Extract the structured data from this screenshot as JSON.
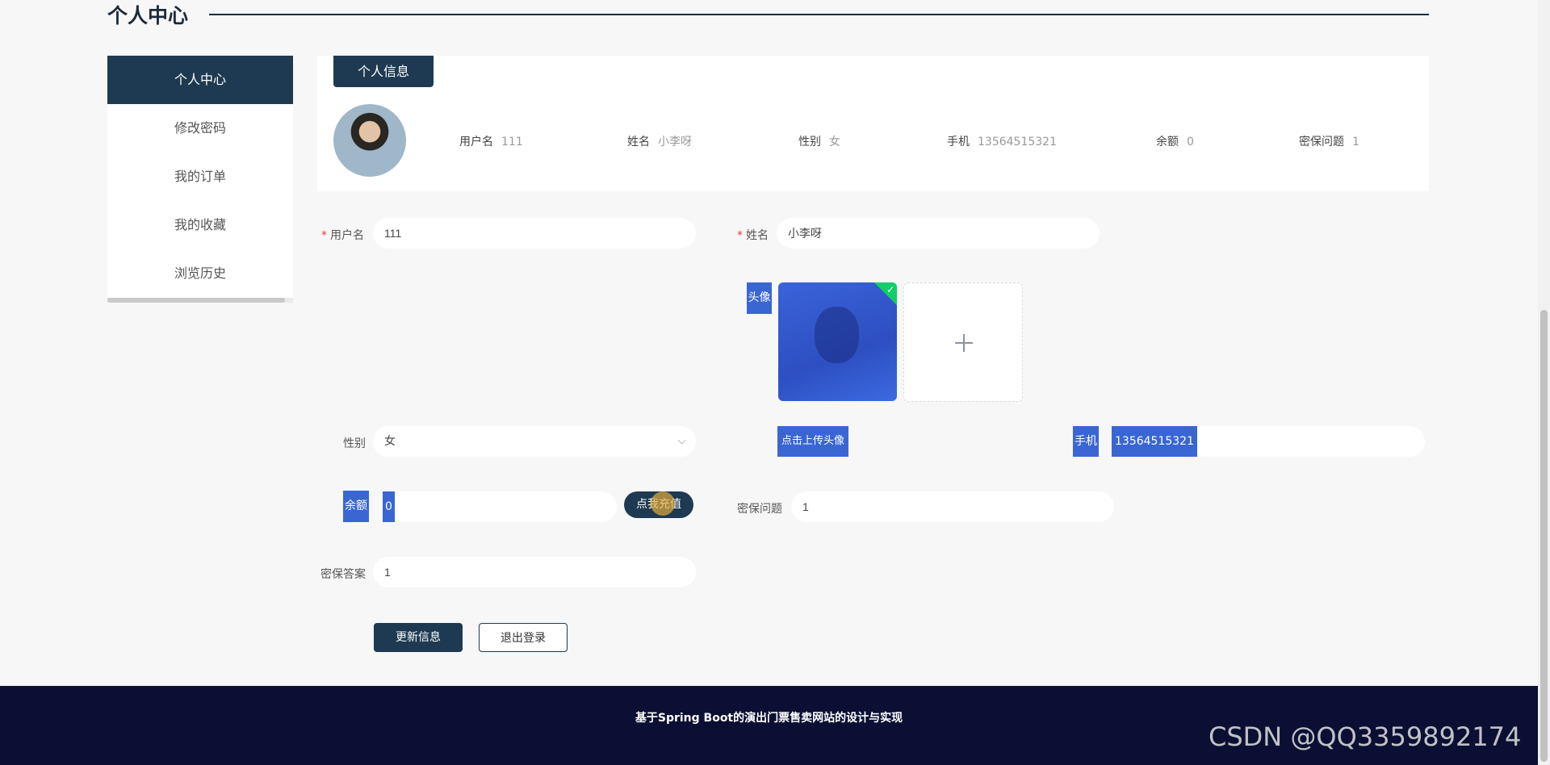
{
  "header": {
    "title": "个人中心"
  },
  "sidebar": {
    "items": [
      {
        "label": "个人中心"
      },
      {
        "label": "修改密码"
      },
      {
        "label": "我的订单"
      },
      {
        "label": "我的收藏"
      },
      {
        "label": "浏览历史"
      }
    ]
  },
  "info_card": {
    "tab_label": "个人信息",
    "fields": [
      {
        "label": "用户名",
        "value": "111"
      },
      {
        "label": "姓名",
        "value": "小李呀"
      },
      {
        "label": "性别",
        "value": "女"
      },
      {
        "label": "手机",
        "value": "13564515321"
      },
      {
        "label": "余额",
        "value": "0"
      },
      {
        "label": "密保问题",
        "value": "1"
      }
    ]
  },
  "form": {
    "username": {
      "required_mark": "*",
      "label": "用户名",
      "value": "111"
    },
    "name": {
      "required_mark": "*",
      "label": "姓名",
      "value": "小李呀"
    },
    "avatar": {
      "label": "头像"
    },
    "upload_button": "点击上传头像",
    "gender": {
      "label": "性别",
      "value": "女"
    },
    "phone": {
      "label": "手机",
      "value": "13564515321"
    },
    "balance": {
      "label": "余额",
      "value": "0"
    },
    "recharge_button": "点我充值",
    "security_question": {
      "label": "密保问题",
      "value": "1"
    },
    "security_answer": {
      "label": "密保答案",
      "value": "1"
    },
    "update_button": "更新信息",
    "logout_button": "退出登录"
  },
  "footer": {
    "text": "基于Spring Boot的演出门票售卖网站的设计与实现"
  },
  "watermark": "CSDN @QQ3359892174",
  "colors": {
    "primary": "#1e3a52",
    "highlight": "#3a66d4",
    "footer_bg": "#0a0f33",
    "success": "#13ce66",
    "required": "#e4393c"
  }
}
